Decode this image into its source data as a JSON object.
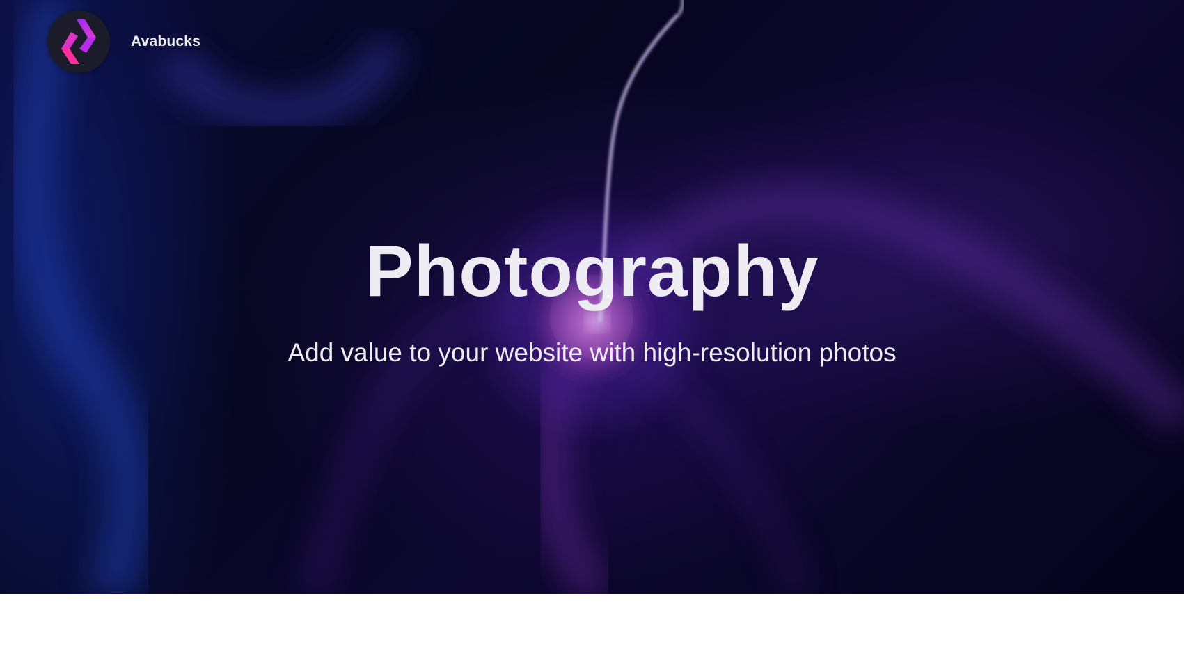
{
  "header": {
    "brand": "Avabucks",
    "logo_icon": "avabucks-logo-icon"
  },
  "hero": {
    "title": "Photography",
    "subtitle": "Add value to your website with high-resolution photos",
    "background_image": "plasma-ball-photo"
  },
  "colors": {
    "hero_dark": "#07061f",
    "accent_purple": "#b830e8",
    "accent_pink": "#ff2fb0",
    "text": "#ececf2",
    "logo_bg": "#1c1b2a"
  }
}
